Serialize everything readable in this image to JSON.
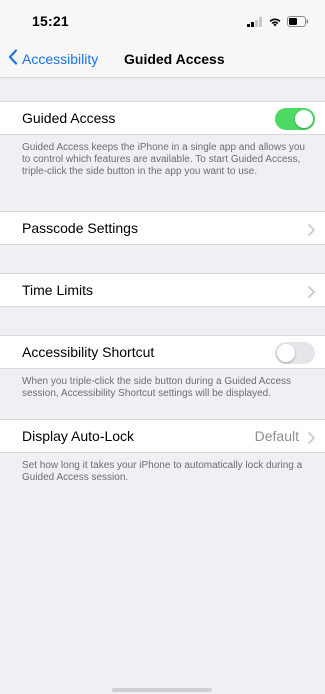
{
  "status_bar": {
    "time": "15:21",
    "icons": [
      "cellular-signal-icon",
      "wifi-icon",
      "battery-icon"
    ]
  },
  "nav": {
    "back_label": "Accessibility",
    "title": "Guided Access"
  },
  "guided_access": {
    "label": "Guided Access",
    "enabled": true,
    "footer": "Guided Access keeps the iPhone in a single app and allows you to control which features are available. To start Guided Access, triple-click the side button in the app you want to use."
  },
  "passcode_settings": {
    "label": "Passcode Settings"
  },
  "time_limits": {
    "label": "Time Limits"
  },
  "accessibility_shortcut": {
    "label": "Accessibility Shortcut",
    "enabled": false,
    "footer": "When you triple-click the side button during a Guided Access session, Accessibility Shortcut settings will be displayed."
  },
  "display_auto_lock": {
    "label": "Display Auto-Lock",
    "value": "Default",
    "footer": "Set how long it takes your iPhone to automatically lock during a Guided Access session."
  },
  "colors": {
    "accent": "#1a73e8",
    "toggle_on": "#4cd964",
    "toggle_off": "#e5e5ea",
    "background": "#efeff4",
    "secondary_text": "#6d6d72"
  }
}
